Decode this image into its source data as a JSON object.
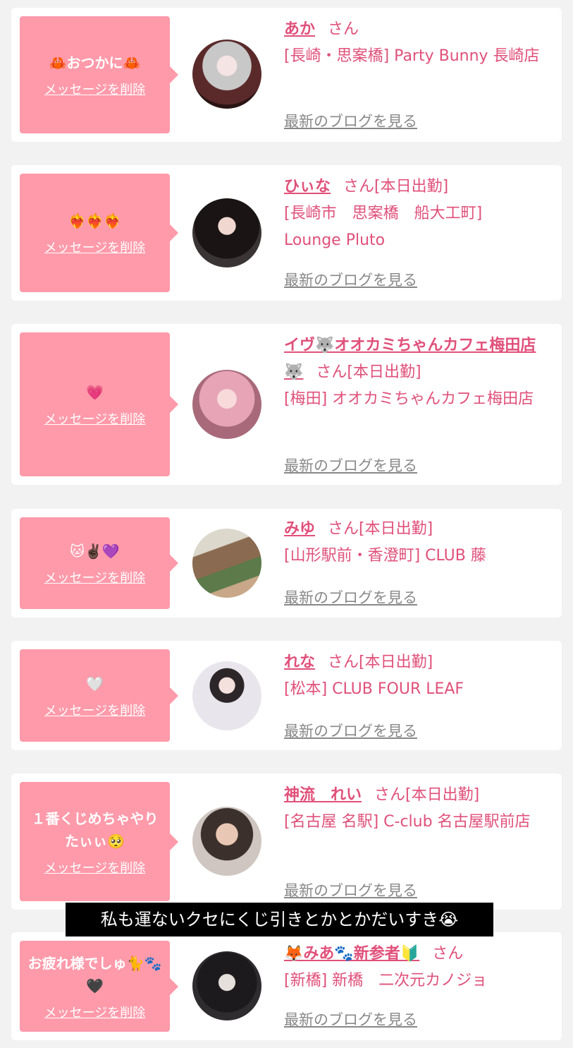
{
  "items": [
    {
      "message": "🦀おつかに🦀",
      "delete_label": "メッセージを削除",
      "name": "あか",
      "honorific": "さん",
      "status": "",
      "shop": "[長崎・思案橋] Party Bunny 長崎店",
      "blog_label": "最新のブログを見る"
    },
    {
      "message": "❤️‍🔥❤️‍🔥❤️‍🔥",
      "delete_label": "メッセージを削除",
      "name": "ひぃな",
      "honorific": "さん",
      "status": "[本日出勤]",
      "shop": "[長崎市　思案橋　船大工町] Lounge Pluto",
      "blog_label": "最新のブログを見る"
    },
    {
      "message": "💗",
      "delete_label": "メッセージを削除",
      "name": "イヴ🐺オオカミちゃんカフェ梅田店🐺",
      "honorific": "さん",
      "status": "[本日出勤]",
      "shop": "[梅田] オオカミちゃんカフェ梅田店",
      "blog_label": "最新のブログを見る"
    },
    {
      "message": "🐱✌🏿💜",
      "delete_label": "メッセージを削除",
      "name": "みゆ",
      "honorific": "さん",
      "status": "[本日出勤]",
      "shop": "[山形駅前・香澄町] CLUB 藤",
      "blog_label": "最新のブログを見る"
    },
    {
      "message": "🤍",
      "delete_label": "メッセージを削除",
      "name": "れな",
      "honorific": "さん",
      "status": "[本日出勤]",
      "shop": "[松本] CLUB FOUR LEAF",
      "blog_label": "最新のブログを見る"
    },
    {
      "message": "１番くじめちゃやりたぃぃ🥺",
      "delete_label": "メッセージを削除",
      "name": "神流　れい",
      "honorific": "さん",
      "status": "[本日出勤]",
      "shop": "[名古屋 名駅] C-club 名古屋駅前店",
      "blog_label": "最新のブログを見る"
    },
    {
      "message": "お疲れ様でしゅ🐈🐾🖤",
      "delete_label": "メッセージを削除",
      "name": "🦊みあ🐾新参者🔰",
      "honorific": "さん",
      "status": "",
      "shop": "[新橋] 新橋　二次元カノジョ",
      "blog_label": "最新のブログを見る"
    }
  ],
  "caption": "私も運ないクセにくじ引きとかとかだいすき😭"
}
